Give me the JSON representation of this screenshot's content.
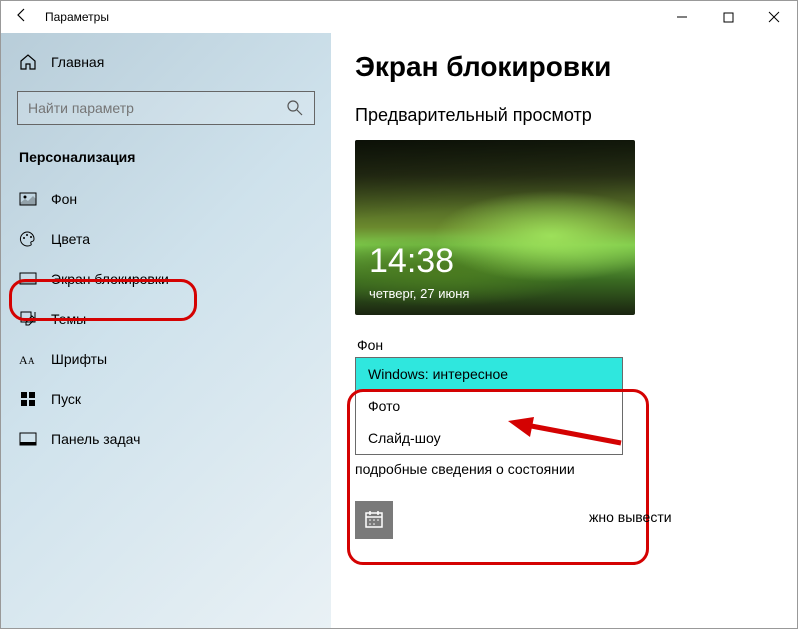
{
  "window": {
    "title": "Параметры"
  },
  "sidebar": {
    "home": "Главная",
    "search_placeholder": "Найти параметр",
    "category": "Персонализация",
    "items": [
      {
        "label": "Фон"
      },
      {
        "label": "Цвета"
      },
      {
        "label": "Экран блокировки"
      },
      {
        "label": "Темы"
      },
      {
        "label": "Шрифты"
      },
      {
        "label": "Пуск"
      },
      {
        "label": "Панель задач"
      }
    ]
  },
  "content": {
    "heading": "Экран блокировки",
    "preview_label": "Предварительный просмотр",
    "clock": "14:38",
    "date": "четверг, 27 июня",
    "background_label": "Фон",
    "dropdown": {
      "options": [
        "Windows: интересное",
        "Фото",
        "Слайд-шоу"
      ],
      "selected_index": 0
    },
    "hint_below": "подробные сведения о состоянии",
    "hint_right": "жно вывести"
  }
}
